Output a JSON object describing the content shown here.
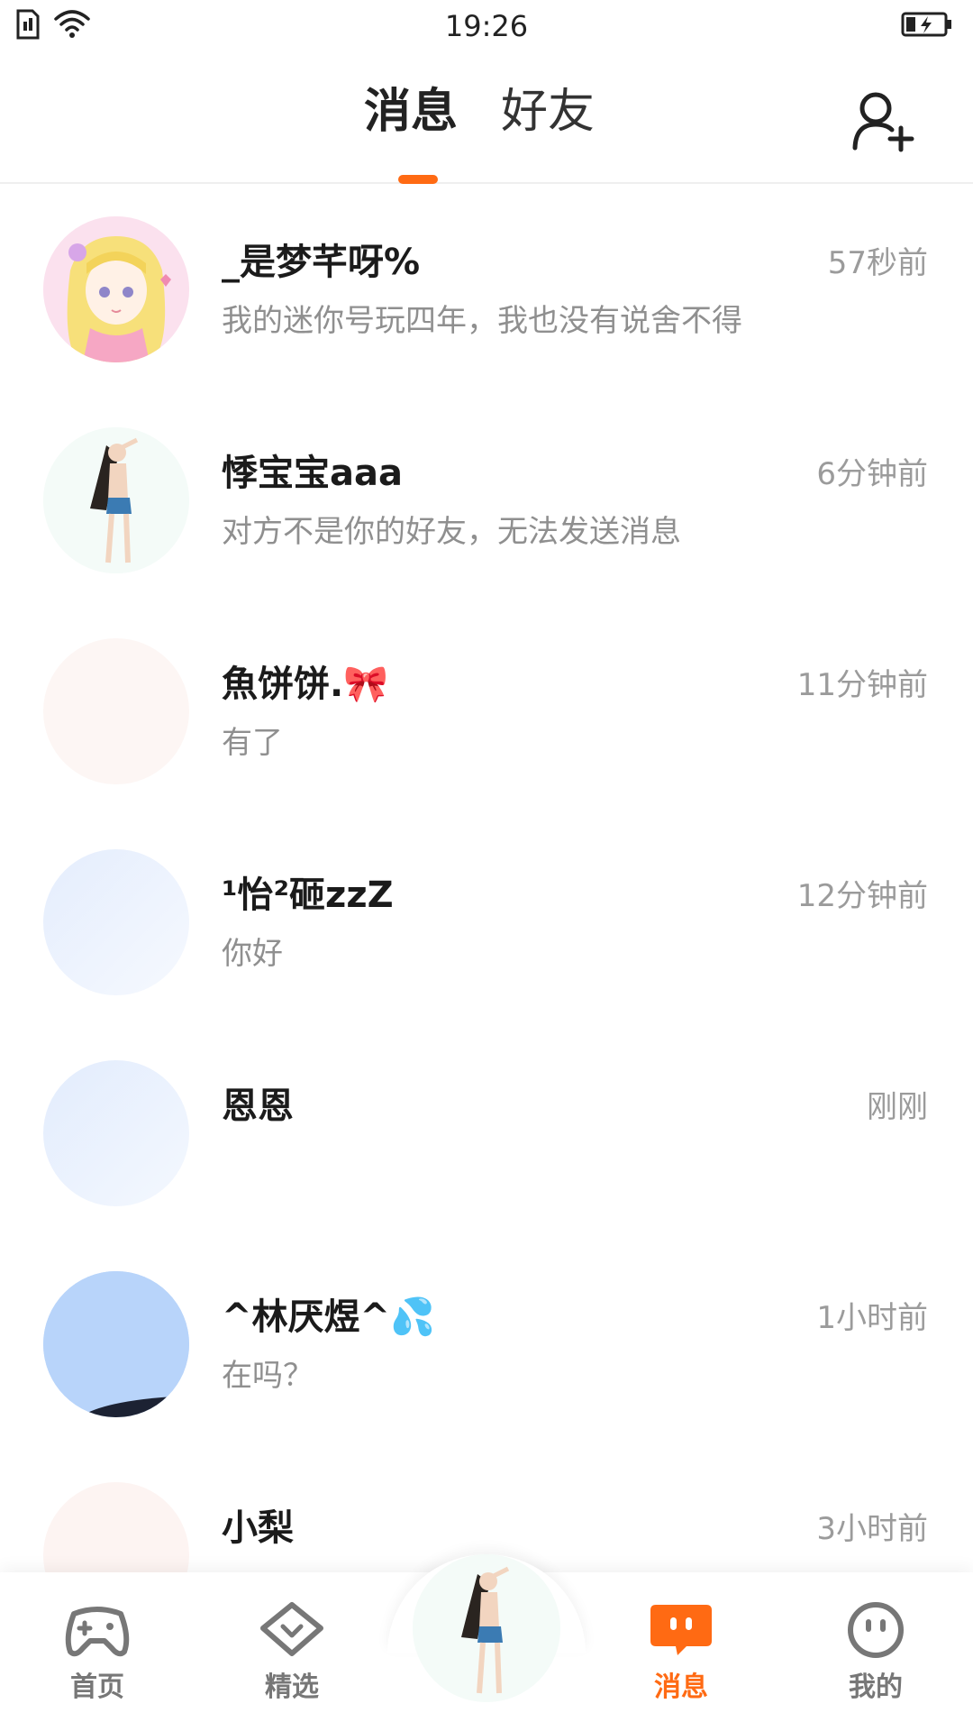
{
  "status_bar": {
    "time": "19:26",
    "icons": [
      "sim-icon",
      "wifi-icon",
      "battery-charging-icon"
    ]
  },
  "header": {
    "tabs": [
      {
        "label": "消息",
        "active": true
      },
      {
        "label": "好友",
        "active": false
      }
    ],
    "add_friend_icon": "add-user-icon",
    "accent_color": "#ff6a13"
  },
  "conversations": [
    {
      "name": "_是梦芊呀%",
      "time": "57秒前",
      "preview": "我的迷你号玩四年，我也没有说舍不得",
      "avatar": "anime-girl-blonde"
    },
    {
      "name": "悸宝宝aaa",
      "time": "6分钟前",
      "preview": "对方不是你的好友，无法发送消息",
      "avatar": "girl-figure"
    },
    {
      "name": "魚饼饼.🎀",
      "time": "11分钟前",
      "preview": "有了",
      "avatar": "pale-pink"
    },
    {
      "name": "¹怡²砸zzZ",
      "time": "12分钟前",
      "preview": "你好",
      "avatar": "pale-blue"
    },
    {
      "name": "恩恩",
      "time": "刚刚",
      "preview": "",
      "avatar": "pale-blue"
    },
    {
      "name": "^林厌煜^💦",
      "time": "1小时前",
      "preview": "在吗？",
      "avatar": "blue-sky"
    },
    {
      "name": "小梨",
      "time": "3小时前",
      "preview": "",
      "avatar": "pale-pink"
    }
  ],
  "bottom_nav": {
    "items": [
      {
        "label": "首页",
        "icon": "gamepad-icon",
        "active": false
      },
      {
        "label": "精选",
        "icon": "heart-chat-icon",
        "active": false
      },
      {
        "label": "消息",
        "icon": "message-icon",
        "active": true
      },
      {
        "label": "我的",
        "icon": "face-icon",
        "active": false
      }
    ],
    "center_avatar": "girl-figure"
  }
}
